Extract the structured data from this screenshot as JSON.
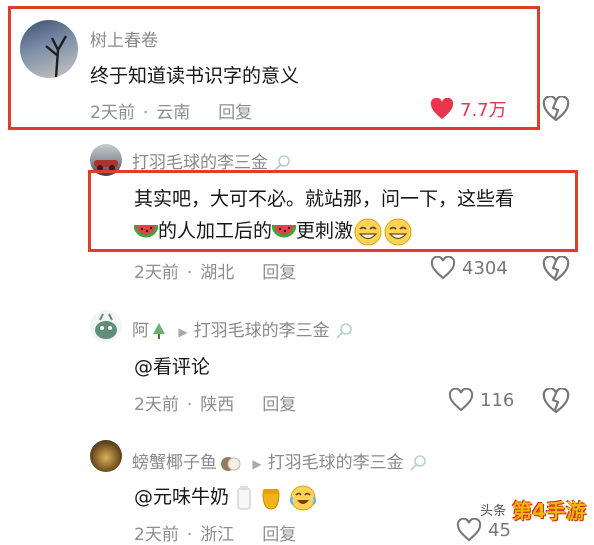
{
  "comments": [
    {
      "username": "树上春卷",
      "text": "终于知道读书识字的意义",
      "time": "2天前",
      "location": "云南",
      "reply_label": "回复",
      "likes": "7.7万",
      "liked": true
    },
    {
      "username": "打羽毛球的李三金",
      "text_line1": "其实吧，大可不必。就站那，问一下，这些看",
      "text_line2_a": "的人加工后的",
      "text_line2_b": "更刺激",
      "time": "2天前",
      "location": "湖北",
      "reply_label": "回复",
      "likes": "4304"
    },
    {
      "username": "阿",
      "reply_to": "打羽毛球的李三金",
      "text": "@看评论",
      "time": "2天前",
      "location": "陕西",
      "reply_label": "回复",
      "likes": "116"
    },
    {
      "username": "螃蟹椰子鱼",
      "reply_to": "打羽毛球的李三金",
      "text": "@元味牛奶",
      "time": "2天前",
      "location": "浙江",
      "reply_label": "回复",
      "likes": "45"
    }
  ],
  "watermark": {
    "source": "头条",
    "brand": "第4手游"
  },
  "colors": {
    "highlight_box": "#e23c2a",
    "liked_heart": "#e9364e",
    "meta_text": "#8e8e8e"
  },
  "icons": [
    "heart-icon",
    "dislike-heart-icon",
    "badminton-icon",
    "tree-icon",
    "reply-arrow-icon",
    "watermelon-emoji",
    "grin-emoji",
    "milk-emoji",
    "honey-emoji",
    "laugh-cry-emoji"
  ]
}
